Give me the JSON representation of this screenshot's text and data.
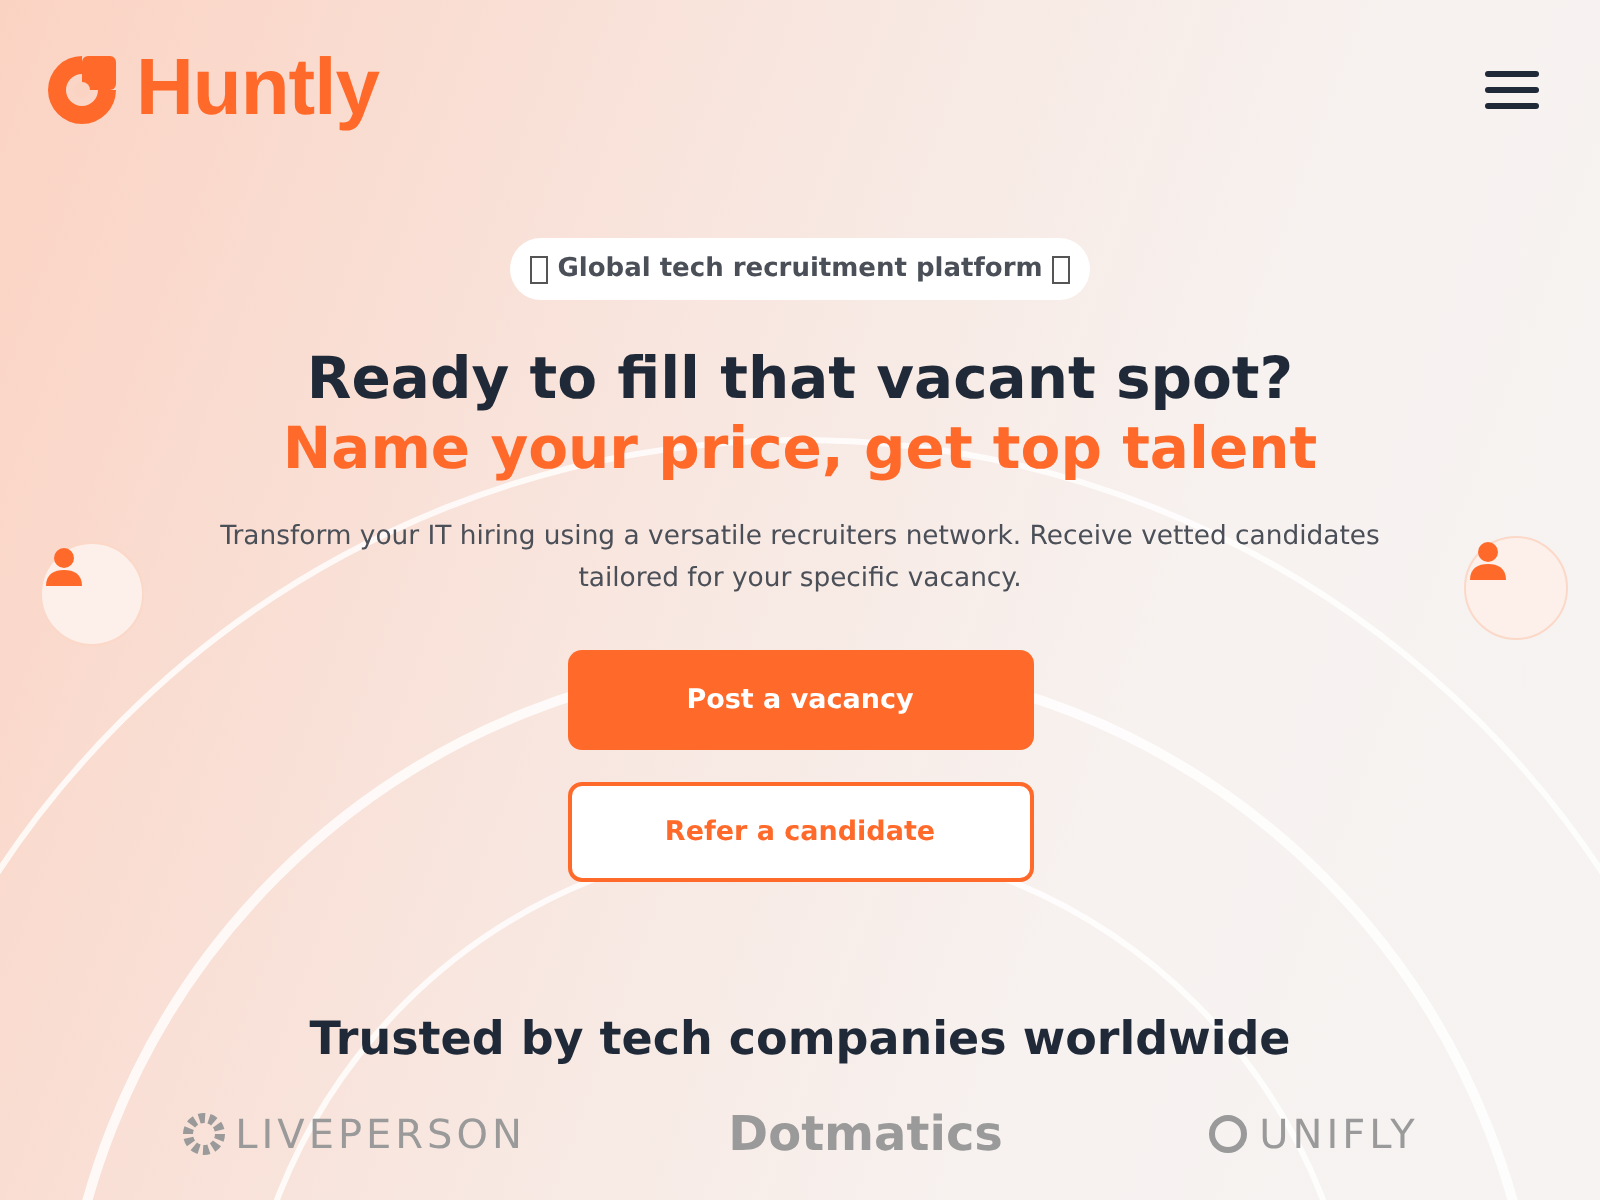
{
  "header": {
    "logo_text": "Huntly"
  },
  "hero": {
    "badge": "Global tech recruitment platform",
    "title": "Ready to fill that vacant spot?",
    "subtitle": "Name your price, get top talent",
    "description": "Transform your IT hiring using a versatile recruiters network. Receive vetted candidates tailored for your specific vacancy.",
    "buttons": [
      {
        "label": "Post a vacancy",
        "kind": "primary"
      },
      {
        "label": "Refer a candidate",
        "kind": "secondary"
      }
    ]
  },
  "trusted": {
    "heading": "Trusted by tech companies worldwide",
    "logos": [
      "LIVEPERSON",
      "Dotmatics",
      "UNIFLY"
    ]
  }
}
